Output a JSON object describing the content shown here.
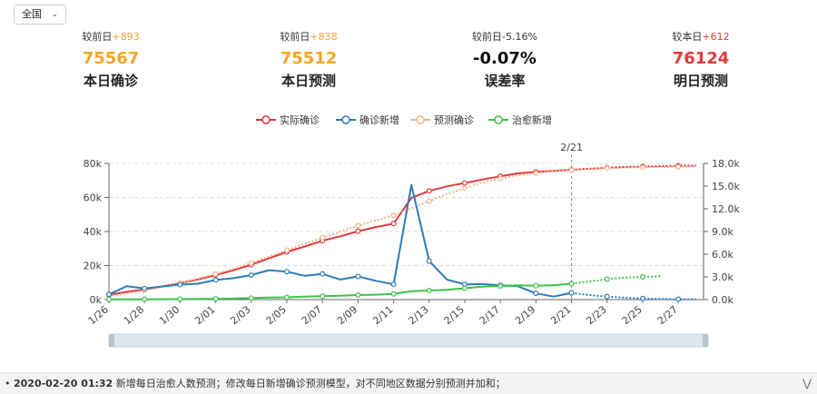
{
  "region_select": {
    "value": "全国"
  },
  "stats": [
    {
      "cmp_label": "较前日",
      "cmp_value": "+893",
      "value": "75567",
      "label": "本日确诊",
      "color": "#f5a623"
    },
    {
      "cmp_label": "较前日",
      "cmp_value": "+838",
      "value": "75512",
      "label": "本日预测",
      "color": "#f5a623"
    },
    {
      "cmp_label": "较前日",
      "cmp_value": "-5.16%",
      "value": "-0.07%",
      "label": "误差率",
      "color": "#111111"
    },
    {
      "cmp_label": "较本日",
      "cmp_value": "+612",
      "value": "76124",
      "label": "明日预测",
      "color": "#e4393c"
    }
  ],
  "chart_data": {
    "type": "line",
    "x": [
      "1/26",
      "1/27",
      "1/28",
      "1/29",
      "1/30",
      "1/31",
      "2/01",
      "2/02",
      "2/03",
      "2/04",
      "2/05",
      "2/06",
      "2/07",
      "2/08",
      "2/09",
      "2/10",
      "2/11",
      "2/12",
      "2/13",
      "2/14",
      "2/15",
      "2/16",
      "2/17",
      "2/18",
      "2/19",
      "2/20",
      "2/21",
      "2/22",
      "2/23",
      "2/24",
      "2/25",
      "2/26",
      "2/27",
      "2/28"
    ],
    "x_tick_labels": [
      "1/26",
      "1/28",
      "1/30",
      "2/01",
      "2/03",
      "2/05",
      "2/07",
      "2/09",
      "2/11",
      "2/13",
      "2/15",
      "2/17",
      "2/19",
      "2/21",
      "2/23",
      "2/25",
      "2/27"
    ],
    "marker_label": "2/21",
    "y_left": {
      "ticks": [
        "0k",
        "20k",
        "40k",
        "60k",
        "80k"
      ],
      "ylim": [
        0,
        80000
      ]
    },
    "y_right": {
      "ticks": [
        "0.0k",
        "3.0k",
        "6.0k",
        "9.0k",
        "12.0k",
        "15.0k",
        "18.0k"
      ],
      "ylim": [
        0,
        18000
      ]
    },
    "legend": [
      "实际确诊",
      "确诊新增",
      "预测确诊",
      "治愈新增"
    ],
    "legend_position": "top-center",
    "grid": true,
    "series": [
      {
        "name": "实际确诊",
        "axis": "left",
        "color": "#e0383e",
        "style": "solid",
        "values": [
          2744,
          4515,
          5974,
          7711,
          9692,
          11791,
          14380,
          17205,
          20438,
          24324,
          28018,
          31161,
          34546,
          37198,
          40171,
          42638,
          44653,
          59804,
          63851,
          66492,
          68500,
          70548,
          72436,
          74185,
          75002,
          75567,
          76288,
          null,
          null,
          null,
          null,
          null,
          null,
          null
        ]
      },
      {
        "name": "实际确诊(预测)",
        "axis": "left",
        "color": "#e0383e",
        "style": "dotted",
        "values": [
          null,
          null,
          null,
          null,
          null,
          null,
          null,
          null,
          null,
          null,
          null,
          null,
          null,
          null,
          null,
          null,
          null,
          null,
          null,
          null,
          null,
          null,
          null,
          null,
          null,
          null,
          76288,
          76900,
          77500,
          77900,
          78200,
          78400,
          78600,
          78800
        ]
      },
      {
        "name": "预测确诊",
        "axis": "left",
        "color": "#f0b58c",
        "style": "dotted",
        "values": [
          2200,
          3600,
          5400,
          7400,
          9700,
          12200,
          15000,
          18200,
          21500,
          25300,
          29000,
          32800,
          36400,
          39900,
          43400,
          46500,
          49500,
          53500,
          57800,
          62000,
          65500,
          68700,
          71200,
          73000,
          74300,
          75500,
          76124,
          76700,
          77200,
          77500,
          77700,
          77900,
          78000,
          78100
        ]
      },
      {
        "name": "确诊新增",
        "axis": "right",
        "color": "#2f7bb7",
        "style": "solid",
        "values": [
          688,
          1770,
          1459,
          1737,
          1982,
          2102,
          2590,
          2829,
          3235,
          3887,
          3694,
          3143,
          3385,
          2652,
          3062,
          2478,
          2015,
          15152,
          5090,
          2641,
          2009,
          2048,
          1886,
          1749,
          820,
          394,
          889,
          null,
          null,
          null,
          null,
          null,
          null,
          null
        ]
      },
      {
        "name": "确诊新增(预测)",
        "axis": "right",
        "color": "#2f7bb7",
        "style": "dotted",
        "values": [
          null,
          null,
          null,
          null,
          null,
          null,
          null,
          null,
          null,
          null,
          null,
          null,
          null,
          null,
          null,
          null,
          null,
          null,
          null,
          null,
          null,
          null,
          null,
          null,
          null,
          null,
          889,
          600,
          400,
          250,
          150,
          80,
          40,
          20
        ]
      },
      {
        "name": "治愈新增",
        "axis": "right",
        "color": "#3fc24a",
        "style": "solid",
        "values": [
          20,
          30,
          40,
          50,
          60,
          80,
          110,
          150,
          200,
          260,
          300,
          380,
          450,
          520,
          600,
          650,
          750,
          1100,
          1200,
          1300,
          1500,
          1700,
          1800,
          1900,
          1850,
          1900,
          2109,
          null,
          null,
          null,
          null,
          null,
          null,
          null
        ]
      },
      {
        "name": "治愈新增(预测)",
        "axis": "right",
        "color": "#3fc24a",
        "style": "dotted",
        "values": [
          null,
          null,
          null,
          null,
          null,
          null,
          null,
          null,
          null,
          null,
          null,
          null,
          null,
          null,
          null,
          null,
          null,
          null,
          null,
          null,
          null,
          null,
          null,
          null,
          null,
          null,
          2109,
          2400,
          2700,
          2900,
          3000,
          3100,
          null,
          null
        ]
      }
    ]
  },
  "footer": {
    "timestamp": "2020-02-20 01:32",
    "text": "新增每日治愈人数预测；修改每日新增确诊预测模型，对不同地区数据分别预测并加和；",
    "expand_icon": "double-chevron-down-icon"
  }
}
